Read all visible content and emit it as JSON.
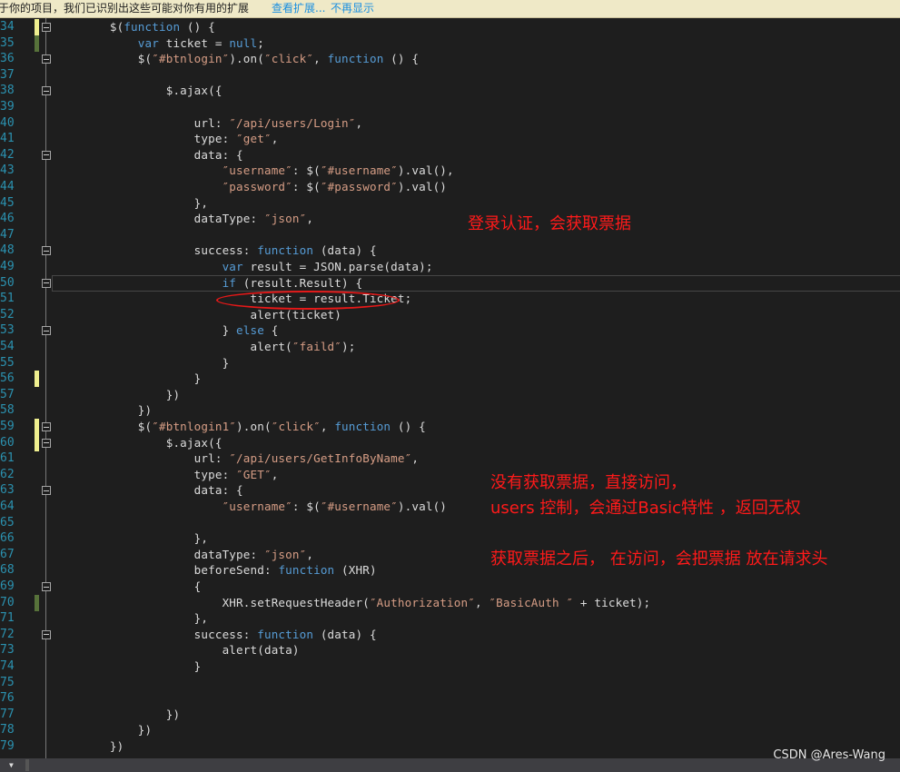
{
  "infobar": {
    "message": "于你的项目，我们已识别出这些可能对你有用的扩展",
    "view_link": "查看扩展...",
    "dismiss_link": "不再显示"
  },
  "colors": {
    "keyword": "#569cd6",
    "string": "#d69d85",
    "text": "#dcdcdc",
    "line_number": "#2b91af",
    "annotation": "#ff1a1a",
    "change_saved": "#57723a",
    "change_unsaved": "#efef8f"
  },
  "editor": {
    "lines": [
      {
        "n": "34",
        "code": "        $(function () {",
        "fold": true,
        "change": "unsaved"
      },
      {
        "n": "35",
        "code": "            var ticket = null;",
        "change": "saved"
      },
      {
        "n": "36",
        "code": "            $(\"#btnlogin\").on(\"click\", function () {",
        "fold": true
      },
      {
        "n": "37",
        "code": ""
      },
      {
        "n": "38",
        "code": "                $.ajax({",
        "fold": true
      },
      {
        "n": "39",
        "code": ""
      },
      {
        "n": "40",
        "code": "                    url: \"/api/users/Login\","
      },
      {
        "n": "41",
        "code": "                    type: \"get\","
      },
      {
        "n": "42",
        "code": "                    data: {",
        "fold": true
      },
      {
        "n": "43",
        "code": "                        \"username\": $(\"#username\").val(),"
      },
      {
        "n": "44",
        "code": "                        \"password\": $(\"#password\").val()"
      },
      {
        "n": "45",
        "code": "                    },"
      },
      {
        "n": "46",
        "code": "                    dataType: \"json\","
      },
      {
        "n": "47",
        "code": ""
      },
      {
        "n": "48",
        "code": "                    success: function (data) {",
        "fold": true
      },
      {
        "n": "49",
        "code": "                        var result = JSON.parse(data);"
      },
      {
        "n": "50",
        "code": "                        if (result.Result) {",
        "fold": true,
        "current": true
      },
      {
        "n": "51",
        "code": "                            ticket = result.Ticket;"
      },
      {
        "n": "52",
        "code": "                            alert(ticket)"
      },
      {
        "n": "53",
        "code": "                        } else {",
        "fold": true
      },
      {
        "n": "54",
        "code": "                            alert(\"faild\");"
      },
      {
        "n": "55",
        "code": "                        }"
      },
      {
        "n": "56",
        "code": "                    }",
        "change": "unsaved"
      },
      {
        "n": "57",
        "code": "                })"
      },
      {
        "n": "58",
        "code": "            })"
      },
      {
        "n": "59",
        "code": "            $(\"#btnlogin1\").on(\"click\", function () {",
        "fold": true,
        "change": "unsaved"
      },
      {
        "n": "60",
        "code": "                $.ajax({",
        "fold": true,
        "change": "unsaved"
      },
      {
        "n": "61",
        "code": "                    url: \"/api/users/GetInfoByName\","
      },
      {
        "n": "62",
        "code": "                    type: \"GET\","
      },
      {
        "n": "63",
        "code": "                    data: {",
        "fold": true
      },
      {
        "n": "64",
        "code": "                        \"username\": $(\"#username\").val()"
      },
      {
        "n": "65",
        "code": ""
      },
      {
        "n": "66",
        "code": "                    },"
      },
      {
        "n": "67",
        "code": "                    dataType: \"json\","
      },
      {
        "n": "68",
        "code": "                    beforeSend: function (XHR)"
      },
      {
        "n": "69",
        "code": "                    {",
        "fold": true
      },
      {
        "n": "70",
        "code": "                        XHR.setRequestHeader(\"Authorization\", \"BasicAuth \" + ticket);",
        "change": "saved"
      },
      {
        "n": "71",
        "code": "                    },"
      },
      {
        "n": "72",
        "code": "                    success: function (data) {",
        "fold": true
      },
      {
        "n": "73",
        "code": "                        alert(data)"
      },
      {
        "n": "74",
        "code": "                    }"
      },
      {
        "n": "75",
        "code": ""
      },
      {
        "n": "76",
        "code": ""
      },
      {
        "n": "77",
        "code": "                })"
      },
      {
        "n": "78",
        "code": "            })"
      },
      {
        "n": "79",
        "code": "        })"
      }
    ]
  },
  "annotations": {
    "login": "登录认证，会获取票据",
    "no_ticket_1": "没有获取票据，直接访问，",
    "no_ticket_2": "users 控制，会通过Basic特性 ，返回无权",
    "with_ticket": "获取票据之后，  在访问，会把票据  放在请求头"
  },
  "watermark": "CSDN @Ares-Wang"
}
